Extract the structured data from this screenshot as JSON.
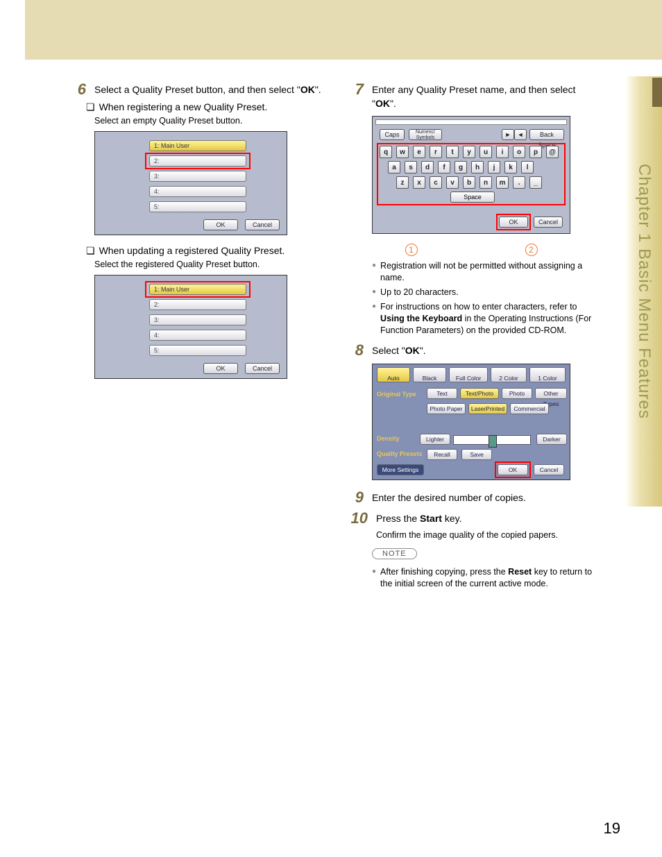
{
  "side_tab": "Chapter 1   Basic Menu Features",
  "page_number": "19",
  "col1": {
    "step6": {
      "num": "6",
      "text_a": "Select a Quality Preset button, and then select \"",
      "ok": "OK",
      "text_b": "\".",
      "sub1": "When registering a new Quality Preset.",
      "sub1_note": "Select an empty Quality Preset button.",
      "sub2": "When updating a registered Quality Preset.",
      "sub2_note": "Select the registered Quality Preset button."
    },
    "shot_list": {
      "rows": [
        "1:  Main User",
        "2:",
        "3:",
        "4:",
        "5:"
      ],
      "ok": "OK",
      "cancel": "Cancel"
    }
  },
  "col2": {
    "step7": {
      "num": "7",
      "text_a": "Enter any Quality Preset name, and then select \"",
      "ok": "OK",
      "text_b": "\"."
    },
    "kbd": {
      "caps": "Caps",
      "numsym": "Numeric/\nSymbols",
      "back": "Back Space",
      "row1": [
        "q",
        "w",
        "e",
        "r",
        "t",
        "y",
        "u",
        "i",
        "o",
        "p",
        "@"
      ],
      "row2": [
        "a",
        "s",
        "d",
        "f",
        "g",
        "h",
        "j",
        "k",
        "l"
      ],
      "row3": [
        "z",
        "x",
        "c",
        "v",
        "b",
        "n",
        "m",
        ".",
        "_"
      ],
      "space": "Space",
      "ok": "OK",
      "cancel": "Cancel",
      "marker1": "1",
      "marker2": "2"
    },
    "step7_bullets": [
      "Registration will not be permitted without assigning a name.",
      "Up to 20 characters.",
      {
        "pre": "For instructions on how to enter characters, refer to ",
        "bold": "Using the Keyboard",
        "post": " in the Operating Instructions (For Function Parameters) on the provided CD-ROM."
      }
    ],
    "step8": {
      "num": "8",
      "text_a": "Select \"",
      "ok": "OK",
      "text_b": "\"."
    },
    "settings": {
      "top_tabs": [
        "Auto",
        "Black",
        "Full Color",
        "2 Color",
        "1 Color"
      ],
      "row_lbl_original": "Original Type",
      "orig_tabs": [
        "Text",
        "Text/Photo",
        "Photo",
        "Other Types"
      ],
      "paper_tabs": [
        "Photo Paper",
        "LaserPrinted",
        "Commercial"
      ],
      "density_lbl": "Density",
      "lighter": "Lighter",
      "darker": "Darker",
      "qp_lbl": "Quality Presets",
      "recall": "Recall",
      "save": "Save",
      "more": "More Settings",
      "ok": "OK",
      "cancel": "Cancel"
    },
    "step9": {
      "num": "9",
      "text": "Enter the desired number of copies."
    },
    "step10": {
      "num": "10",
      "text_a": "Press the ",
      "bold": "Start",
      "text_b": " key.",
      "sub": "Confirm the image quality of the copied papers."
    },
    "note_label": "NOTE",
    "note_bullet": {
      "pre": "After finishing copying, press the ",
      "bold": "Reset",
      "post": " key to return to the initial screen of the current active mode."
    }
  }
}
